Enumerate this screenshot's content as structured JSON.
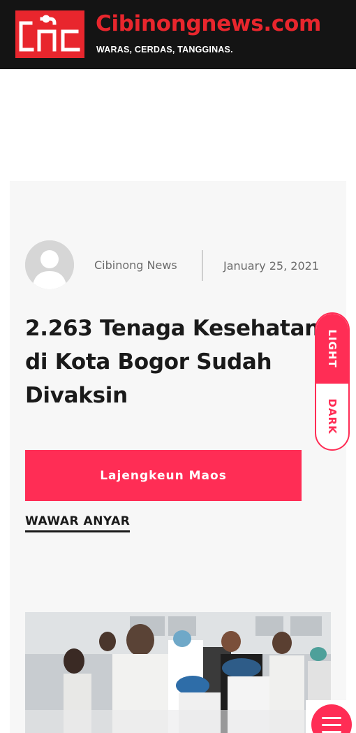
{
  "header": {
    "site_name": "Cibinongnews.com",
    "tagline": "WARAS, CERDAS, TANGGINAS.",
    "logo_icon": "cnc-logo-icon"
  },
  "post": {
    "author": "Cibinong News",
    "date": "January 25, 2021",
    "title_lines": [
      "2.263 Tenaga Kesehatan",
      "di Kota Bogor Sudah",
      "Divaksin"
    ],
    "read_more_label": "Lajengkeun Maos"
  },
  "section": {
    "heading": "WAWAR ANYAR"
  },
  "theme_switch": {
    "light_label": "LIGHT",
    "dark_label": "DARK"
  },
  "colors": {
    "brand_red": "#e8262d",
    "accent_pink": "#ff2d55",
    "header_bg": "#141414"
  },
  "icons": {
    "menu": "hamburger-menu-icon",
    "avatar": "default-avatar-icon"
  }
}
